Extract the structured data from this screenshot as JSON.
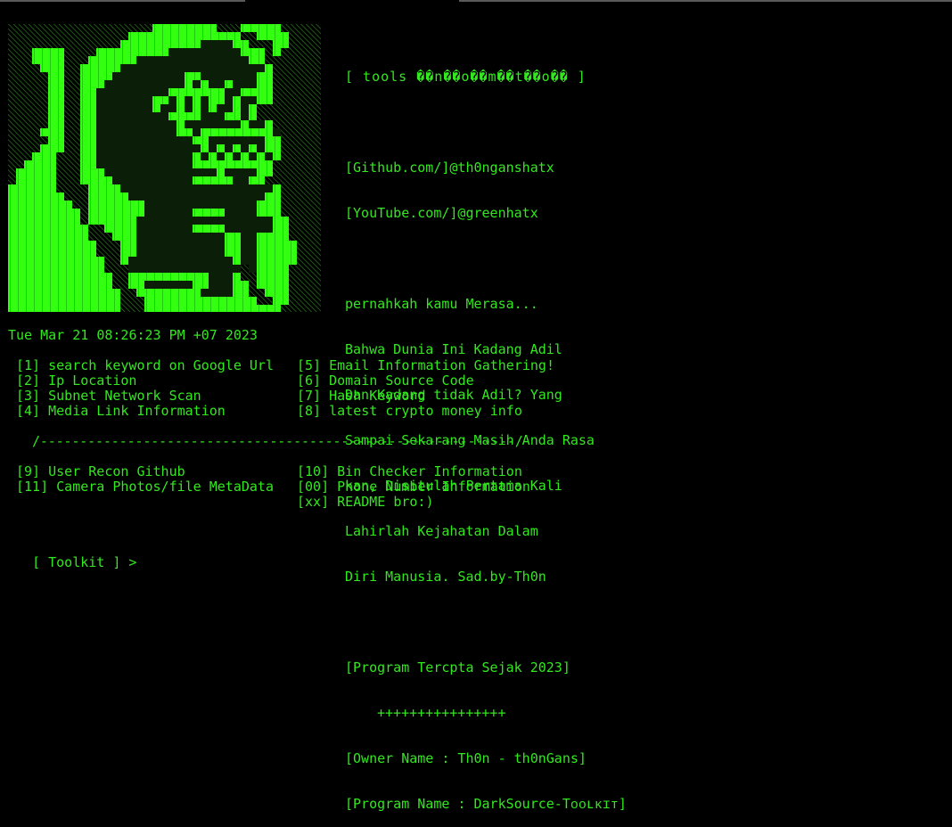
{
  "colors": {
    "fg": "#33e81f",
    "bg": "#000000",
    "accent": "#33ff11"
  },
  "art": {
    "icon": "ascii-face-art"
  },
  "header": {
    "tools_line": "[ tools ��n��o��m��t��o�� ]",
    "github": "[Github.com/]@th0nganshatx",
    "youtube": "[YouTube.com/]@greenhatx",
    "poem": [
      "pernahkah kamu Merasa...",
      "Bahwa Dunia Ini Kadang Adil",
      "Dan Kadang tidak Adil? Yang",
      "Sampai Sekarang Masih Anda Rasa",
      "kan, Disitulah Pertama Kali",
      "Lahirlah Kejahatan Dalam",
      "Diri Manusia. Sad.by-Th0n"
    ],
    "since": "[Program Tercpta Sejak 2023]",
    "plus_line": "++++++++++++++++",
    "owner": "[Owner Name : Th0n - th0nGans]",
    "program": "[Program Name : DarkSource-Tᴏᴏʟᴋɪᴛ]"
  },
  "timestamp": "Tue Mar 21 08:26:23 PM +07 2023",
  "menu_left": [
    "[1] search keyword on Google Url",
    "[2] Ip Location",
    "[3] Subnet Network Scan",
    "[4] Media Link Information"
  ],
  "menu_right": [
    "[5] Email Information Gathering!",
    "[6] Domain Source Code",
    "[7] Hash Keyword",
    "[8] latest crypto money info"
  ],
  "divider": "/------------------------------------------------------------/",
  "menu2_left": [
    "[9] User Recon Github",
    "[11] Camera Photos/file MetaData"
  ],
  "menu2_right": [
    "[10] Bin Checker Information",
    "[00] Phone Number Information",
    "[xx] README bro:)"
  ],
  "prompt": "[ Toolkit ] >"
}
